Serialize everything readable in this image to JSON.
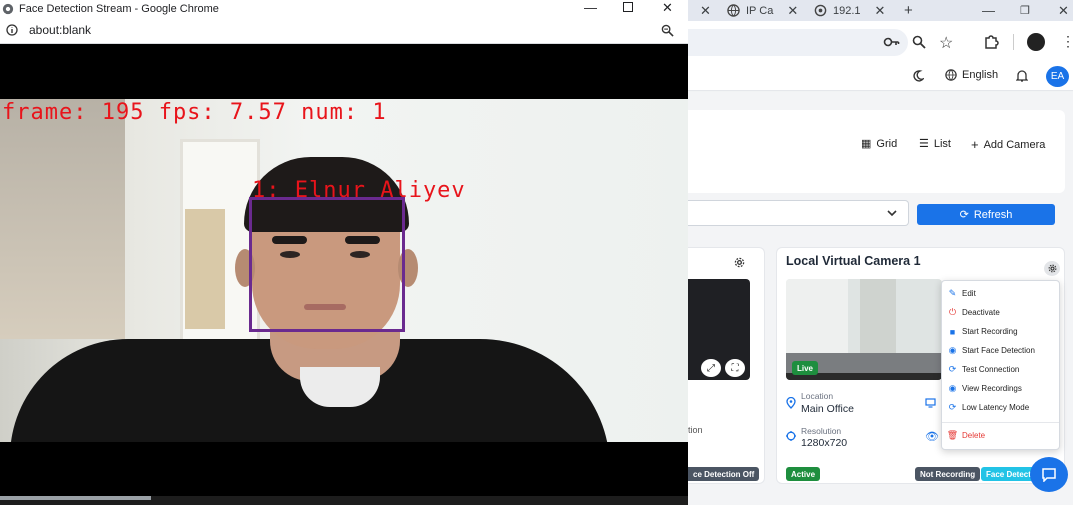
{
  "popup": {
    "title": "Face Detection Stream - Google Chrome",
    "address": "about:blank"
  },
  "stream": {
    "overlay_stats": "frame: 195 fps: 7.57 num: 1",
    "face_label": "1: Elnur Aliyev"
  },
  "browser": {
    "tabs": [
      {
        "label": ""
      },
      {
        "label": "IP Ca"
      },
      {
        "label": "192.1"
      }
    ]
  },
  "app": {
    "language": "English",
    "avatar_initials": "EA",
    "view_buttons": {
      "grid": "Grid",
      "list": "List",
      "add": "Add Camera"
    },
    "refresh": "Refresh",
    "left_card": {
      "field_fragment": "tion",
      "badge": "ce Detection Off"
    },
    "camera": {
      "title": "Local Virtual Camera 1",
      "live": "Live",
      "location_label": "Location",
      "location_value": "Main Office",
      "resolution_label": "Resolution",
      "resolution_value": "1280x720",
      "badges": {
        "active": "Active",
        "recording": "Not Recording",
        "face": "Face Detecti"
      }
    },
    "menu": [
      {
        "label": "Edit",
        "icon": "pencil-icon"
      },
      {
        "label": "Deactivate",
        "icon": "power-icon"
      },
      {
        "label": "Start Recording",
        "icon": "video-icon"
      },
      {
        "label": "Start Face Detection",
        "icon": "eye-icon"
      },
      {
        "label": "Test Connection",
        "icon": "refresh-icon"
      },
      {
        "label": "View Recordings",
        "icon": "eye-icon"
      },
      {
        "label": "Low Latency Mode",
        "icon": "refresh-icon"
      },
      {
        "label": "Delete",
        "icon": "trash-icon"
      }
    ]
  },
  "colors": {
    "accent": "#1a73e8",
    "danger": "#e53935",
    "success": "#1e8e3e",
    "overlay_text": "#e8141b",
    "face_box": "#6a2a8f"
  }
}
